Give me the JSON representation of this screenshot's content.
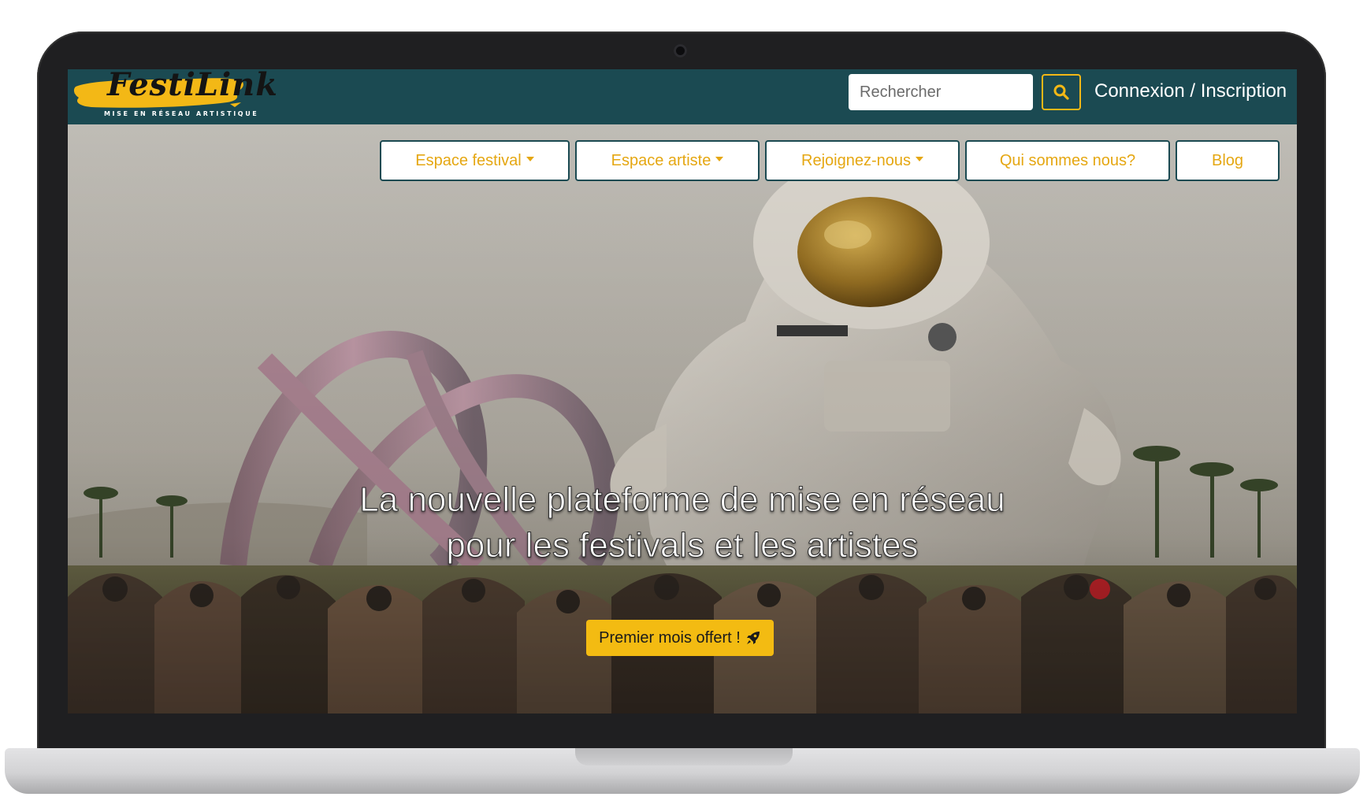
{
  "brand": {
    "name": "FestiLink",
    "tagline": "MISE EN RÉSEAU ARTISTIQUE",
    "accent_color": "#f3b816",
    "navbar_color": "#1b4a52"
  },
  "header": {
    "search": {
      "placeholder": "Rechercher",
      "button_icon": "search-icon"
    },
    "login_label": "Connexion / Inscription"
  },
  "menu": {
    "items": [
      {
        "label": "Espace festival",
        "dropdown": true
      },
      {
        "label": "Espace artiste",
        "dropdown": true
      },
      {
        "label": "Rejoignez-nous",
        "dropdown": true
      },
      {
        "label": "Qui sommes nous?",
        "dropdown": false
      },
      {
        "label": "Blog",
        "dropdown": false
      }
    ]
  },
  "hero": {
    "title_line1": "La nouvelle plateforme de mise en réseau",
    "title_line2": "pour les festivals et les artistes",
    "cta_label": "Premier mois offert !",
    "cta_icon": "rocket-icon",
    "background": "festival-crowd-astronaut-photo"
  }
}
